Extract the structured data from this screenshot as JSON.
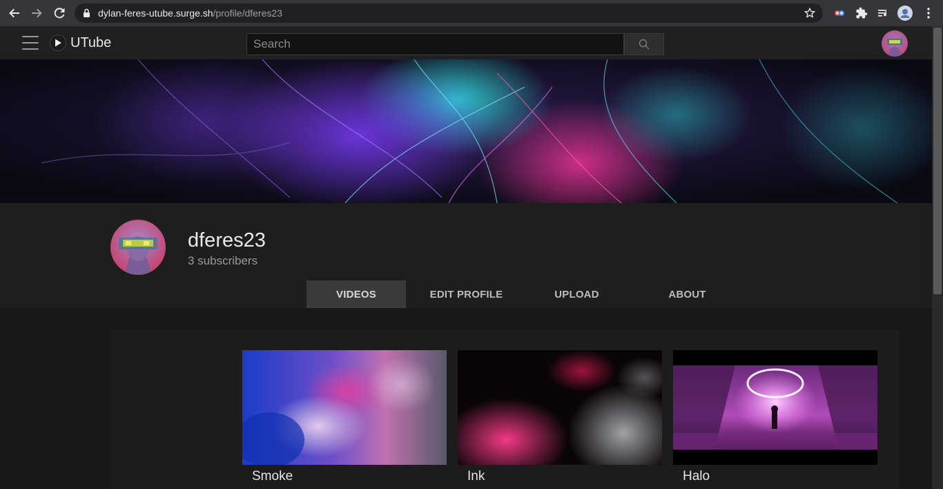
{
  "browser": {
    "url_host": "dylan-feres-utube.surge.sh",
    "url_path": "/profile/dferes23",
    "back_icon": "arrow-left-icon",
    "forward_icon": "arrow-right-icon",
    "reload_icon": "reload-icon"
  },
  "app": {
    "logo_text": "UTube",
    "search_placeholder": "Search"
  },
  "profile": {
    "name": "dferes23",
    "subscribers": "3 subscribers"
  },
  "tabs": [
    {
      "label": "VIDEOS",
      "active": true
    },
    {
      "label": "EDIT PROFILE",
      "active": false
    },
    {
      "label": "UPLOAD",
      "active": false
    },
    {
      "label": "ABOUT",
      "active": false
    }
  ],
  "videos": [
    {
      "title": "Smoke"
    },
    {
      "title": "Ink"
    },
    {
      "title": "Halo"
    }
  ],
  "colors": {
    "accent_pink": "#e0328f",
    "accent_cyan": "#2ee6e6",
    "accent_purple": "#7a3cff"
  }
}
